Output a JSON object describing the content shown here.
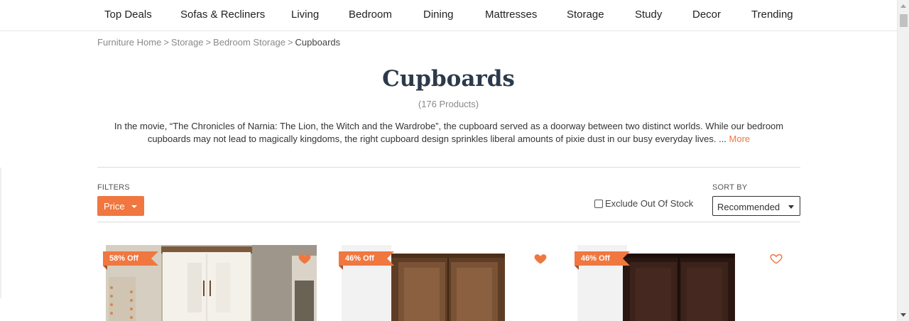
{
  "nav": {
    "items": [
      "Top Deals",
      "Sofas & Recliners",
      "Living",
      "Bedroom",
      "Dining",
      "Mattresses",
      "Storage",
      "Study",
      "Decor",
      "Trending"
    ]
  },
  "breadcrumb": {
    "items": [
      "Furniture Home",
      "Storage",
      "Bedroom Storage"
    ],
    "current": "Cupboards",
    "separator": ">"
  },
  "page": {
    "title": "Cupboards",
    "count": "(176 Products)",
    "description": "In the movie, “The Chronicles of Narnia: The Lion, the Witch and the Wardrobe”, the cupboard served as a doorway between two distinct worlds. While our bedroom cupboards may not lead to magically kingdoms, the right cupboard design sprinkles liberal amounts of pixie dust in our busy everyday lives. ... ",
    "more_label": "More"
  },
  "filters": {
    "label": "FILTERS",
    "price_label": "Price",
    "exclude_label": "Exclude Out Of Stock",
    "exclude_checked": false
  },
  "sort": {
    "label": "SORT BY",
    "selected": "Recommended"
  },
  "products": [
    {
      "discount": "58% Off",
      "wishlisted": true,
      "wishlist_icon": "heart-filled-icon"
    },
    {
      "discount": "46% Off",
      "wishlisted": true,
      "wishlist_icon": "heart-filled-icon"
    },
    {
      "discount": "46% Off",
      "wishlisted": false,
      "wishlist_icon": "heart-outline-icon"
    }
  ],
  "colors": {
    "accent": "#f0773f",
    "title": "#2c3a4b"
  }
}
